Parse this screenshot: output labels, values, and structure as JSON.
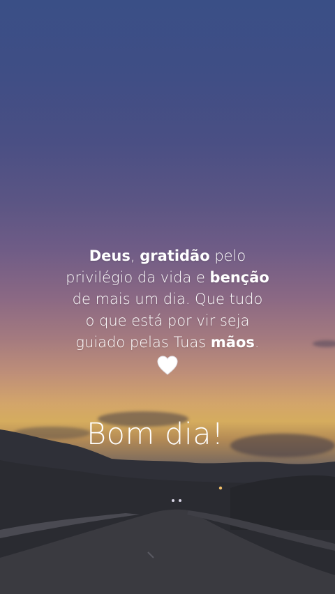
{
  "message": {
    "w1": "Deus",
    "t1": ", ",
    "w2": "gratidão",
    "t2": " pelo",
    "t3": "privilégio da vida e ",
    "w3": "benção",
    "t4": "de mais um dia. Que tudo",
    "t5": "o que está por vir seja",
    "t6": "guiado  pelas Tuas ",
    "w4": "mãos",
    "t7": ".",
    "heart": "white-heart-icon"
  },
  "greeting": "Bom dia!"
}
